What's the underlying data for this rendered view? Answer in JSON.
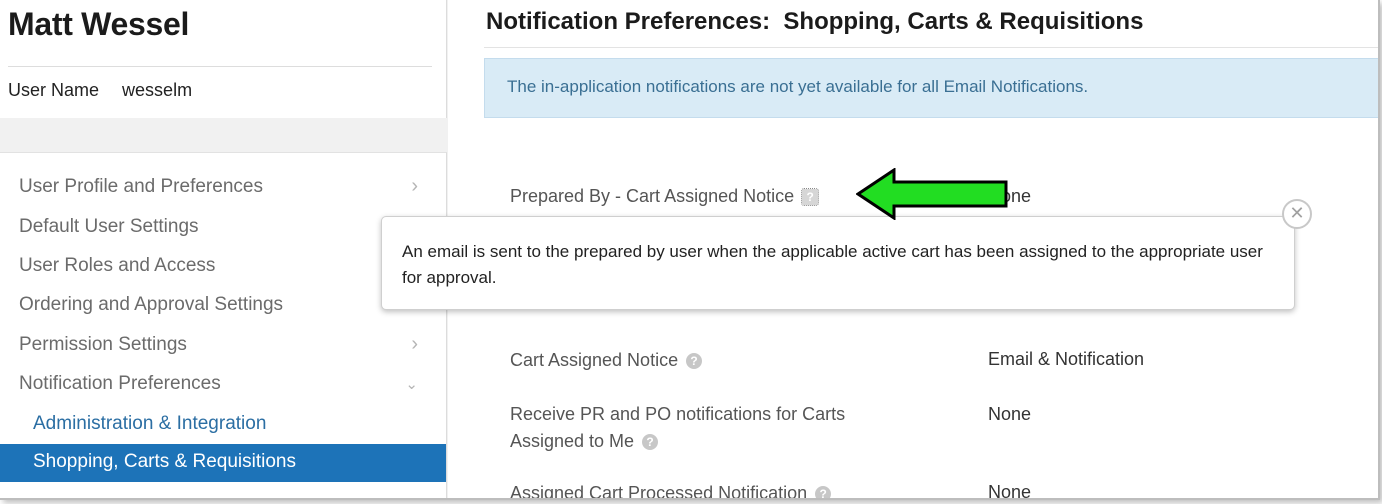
{
  "user": {
    "name": "Matt Wessel",
    "username_label": "User Name",
    "username_value": "wesselm"
  },
  "nav": {
    "items": [
      {
        "label": "User Profile and Preferences",
        "chevron": "chevron-right"
      },
      {
        "label": "Default User Settings",
        "chevron": ""
      },
      {
        "label": "User Roles and Access",
        "chevron": ""
      },
      {
        "label": "Ordering and Approval Settings",
        "chevron": ""
      },
      {
        "label": "Permission Settings",
        "chevron": "chevron-right"
      },
      {
        "label": "Notification Preferences",
        "chevron": "chevron-down"
      }
    ],
    "sub_items": [
      {
        "label": "Administration & Integration"
      },
      {
        "label": "Shopping, Carts & Requisitions",
        "active": true
      }
    ]
  },
  "main": {
    "title": "Notification Preferences:  Shopping, Carts & Requisitions",
    "banner": "The in-application notifications are not yet available for all Email Notifications.",
    "prefs": [
      {
        "label": "Prepared By - Cart Assigned Notice",
        "value": "None"
      },
      {
        "label": "Cart Assigned Notice",
        "value": "Email & Notification"
      },
      {
        "label_line1": "Receive PR and PO notifications for Carts",
        "label_line2": "Assigned to Me",
        "value": "None"
      },
      {
        "label": "Assigned Cart Processed Notification",
        "value": "None"
      }
    ],
    "tooltip": "An email is sent to the prepared by user when the applicable active cart has been assigned to the appropriate user for approval.",
    "help_glyph": "?",
    "close_glyph": "✕"
  },
  "colors": {
    "accent_blue": "#1d73b8",
    "banner_bg": "#d9ebf6",
    "arrow_green": "#22dd22"
  }
}
